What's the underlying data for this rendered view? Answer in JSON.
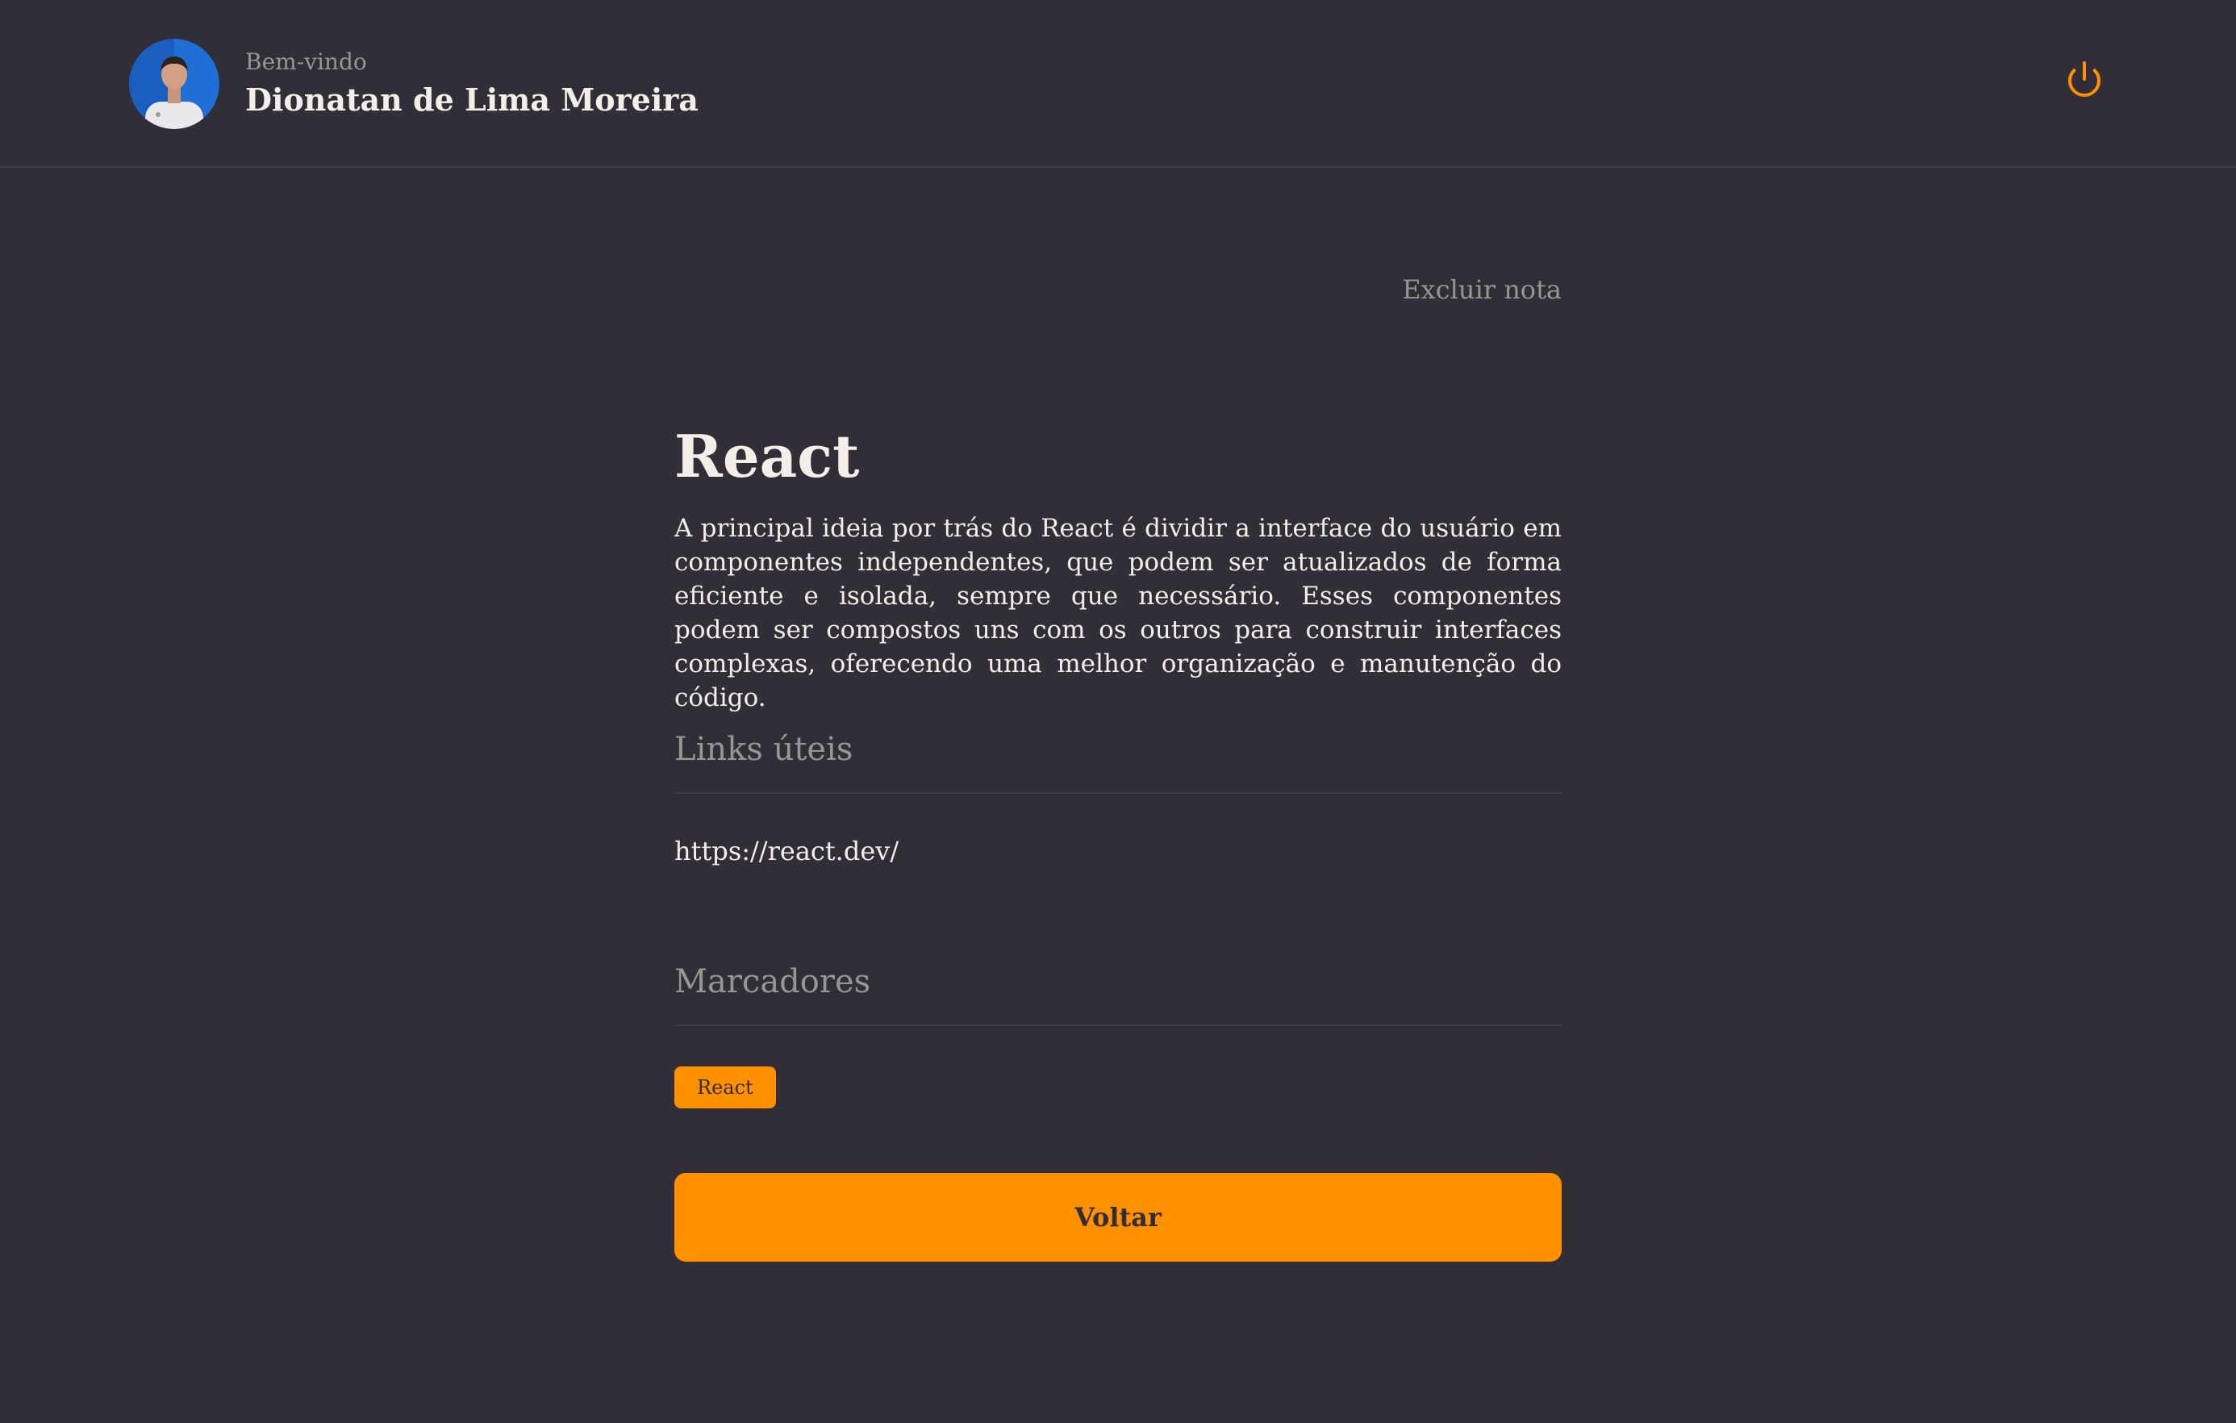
{
  "header": {
    "welcome_label": "Bem-vindo",
    "user_name": "Dionatan de Lima Moreira",
    "logout_icon": "power-icon",
    "accent_color": "#ff9000"
  },
  "note": {
    "delete_label": "Excluir nota",
    "title": "React",
    "description": "A principal ideia por trás do React é dividir a interface do usuário em componentes independentes, que podem ser atualizados de forma eficiente e isolada, sempre que necessário. Esses componentes podem ser compostos uns com os outros para construir interfaces complexas, oferecendo uma melhor organização e manutenção do código.",
    "links_section_title": "Links úteis",
    "links": [
      "https://react.dev/"
    ],
    "tags_section_title": "Marcadores",
    "tags": [
      "React"
    ],
    "back_label": "Voltar"
  }
}
